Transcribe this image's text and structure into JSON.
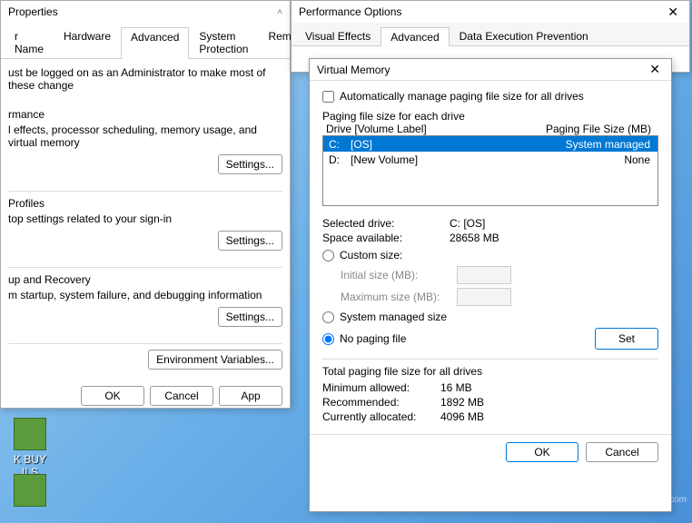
{
  "props": {
    "title": "Properties",
    "tabs": [
      "r Name",
      "Hardware",
      "Advanced",
      "System Protection",
      "Remote"
    ],
    "active_tab": 2,
    "admin_note": "ust be logged on as an Administrator to make most of these change",
    "perf_label": "rmance",
    "perf_desc": "l effects, processor scheduling, memory usage, and virtual memory",
    "profiles_label": "Profiles",
    "profiles_desc": "top settings related to your sign-in",
    "recovery_label": "up and Recovery",
    "recovery_desc": "m startup, system failure, and debugging information",
    "settings_btn": "Settings...",
    "env_btn": "Environment Variables...",
    "ok": "OK",
    "cancel": "Cancel",
    "apply": "App"
  },
  "perf": {
    "title": "Performance Options",
    "tabs": [
      "Visual Effects",
      "Advanced",
      "Data Execution Prevention"
    ],
    "active_tab": 1
  },
  "vm": {
    "title": "Virtual Memory",
    "auto_label": "Automatically manage paging file size for all drives",
    "auto_checked": false,
    "list_label": "Paging file size for each drive",
    "col_drive": "Drive  [Volume Label]",
    "col_size": "Paging File Size (MB)",
    "drives": [
      {
        "letter": "C:",
        "vol": "[OS]",
        "size": "System managed",
        "selected": true
      },
      {
        "letter": "D:",
        "vol": "[New Volume]",
        "size": "None",
        "selected": false
      }
    ],
    "sel_drive_k": "Selected drive:",
    "sel_drive_v": "C:  [OS]",
    "space_k": "Space available:",
    "space_v": "28658 MB",
    "r_custom": "Custom size:",
    "initial_lbl": "Initial size (MB):",
    "max_lbl": "Maximum size (MB):",
    "r_sysmanaged": "System managed size",
    "r_nopaging": "No paging file",
    "radio_checked": "nopaging",
    "set": "Set",
    "totals_label": "Total paging file size for all drives",
    "min_k": "Minimum allowed:",
    "min_v": "16 MB",
    "rec_k": "Recommended:",
    "rec_v": "1892 MB",
    "cur_k": "Currently allocated:",
    "cur_v": "4096 MB",
    "ok": "OK",
    "cancel": "Cancel"
  },
  "desktop": {
    "icon1": "K BUY\nILS",
    "watermark": "wsxdn.com"
  }
}
